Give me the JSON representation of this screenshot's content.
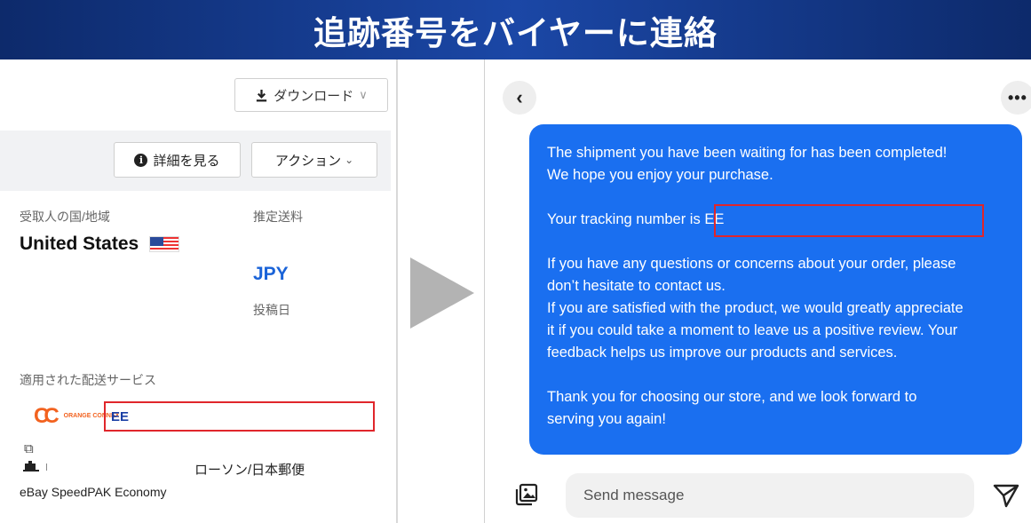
{
  "banner": {
    "title": "追跡番号をバイヤーに連絡"
  },
  "left_panel": {
    "download_label": "ダウンロード",
    "download_chevron": "∨",
    "details_label": "詳細を見る",
    "details_icon": "i",
    "action_label": "アクション",
    "action_chevron": "⌄",
    "recipient_country_label": "受取人の国/地域",
    "recipient_country": "United States",
    "estimated_shipping_label": "推定送料",
    "currency": "JPY",
    "post_date_label": "投稿日",
    "applied_service_label": "適用された配送サービス",
    "carrier_logo_text": "ORANGE CONNEX",
    "tracking_number": "EE",
    "pickup_label": "ローソン/日本郵便",
    "service_name": "eBay SpeedPAK Economy"
  },
  "chat": {
    "back_icon": "‹",
    "more_icon": "•••",
    "message": {
      "line1": "The shipment you have been waiting for has been completed!",
      "line2": "We hope you enjoy your purchase.",
      "tracking_prefix": "Your tracking number is ",
      "tracking_number": "EE",
      "line4": "If you have any questions or concerns about your order, please",
      "line5": "don’t hesitate to contact us.",
      "line6": "If you are satisfied with the product, we would greatly appreciate",
      "line7": "it if you could take a moment to leave us a positive review. Your",
      "line8": "feedback helps us improve our products and services.",
      "line9": "Thank you for choosing our store, and we look forward to",
      "line10": "serving you again!"
    },
    "input_placeholder": "Send message"
  },
  "colors": {
    "banner": "#1b47a6",
    "bubble": "#1a6ff0",
    "highlight": "#e0262b",
    "currency": "#1a63d8",
    "carrier_orange": "#f2621f"
  }
}
